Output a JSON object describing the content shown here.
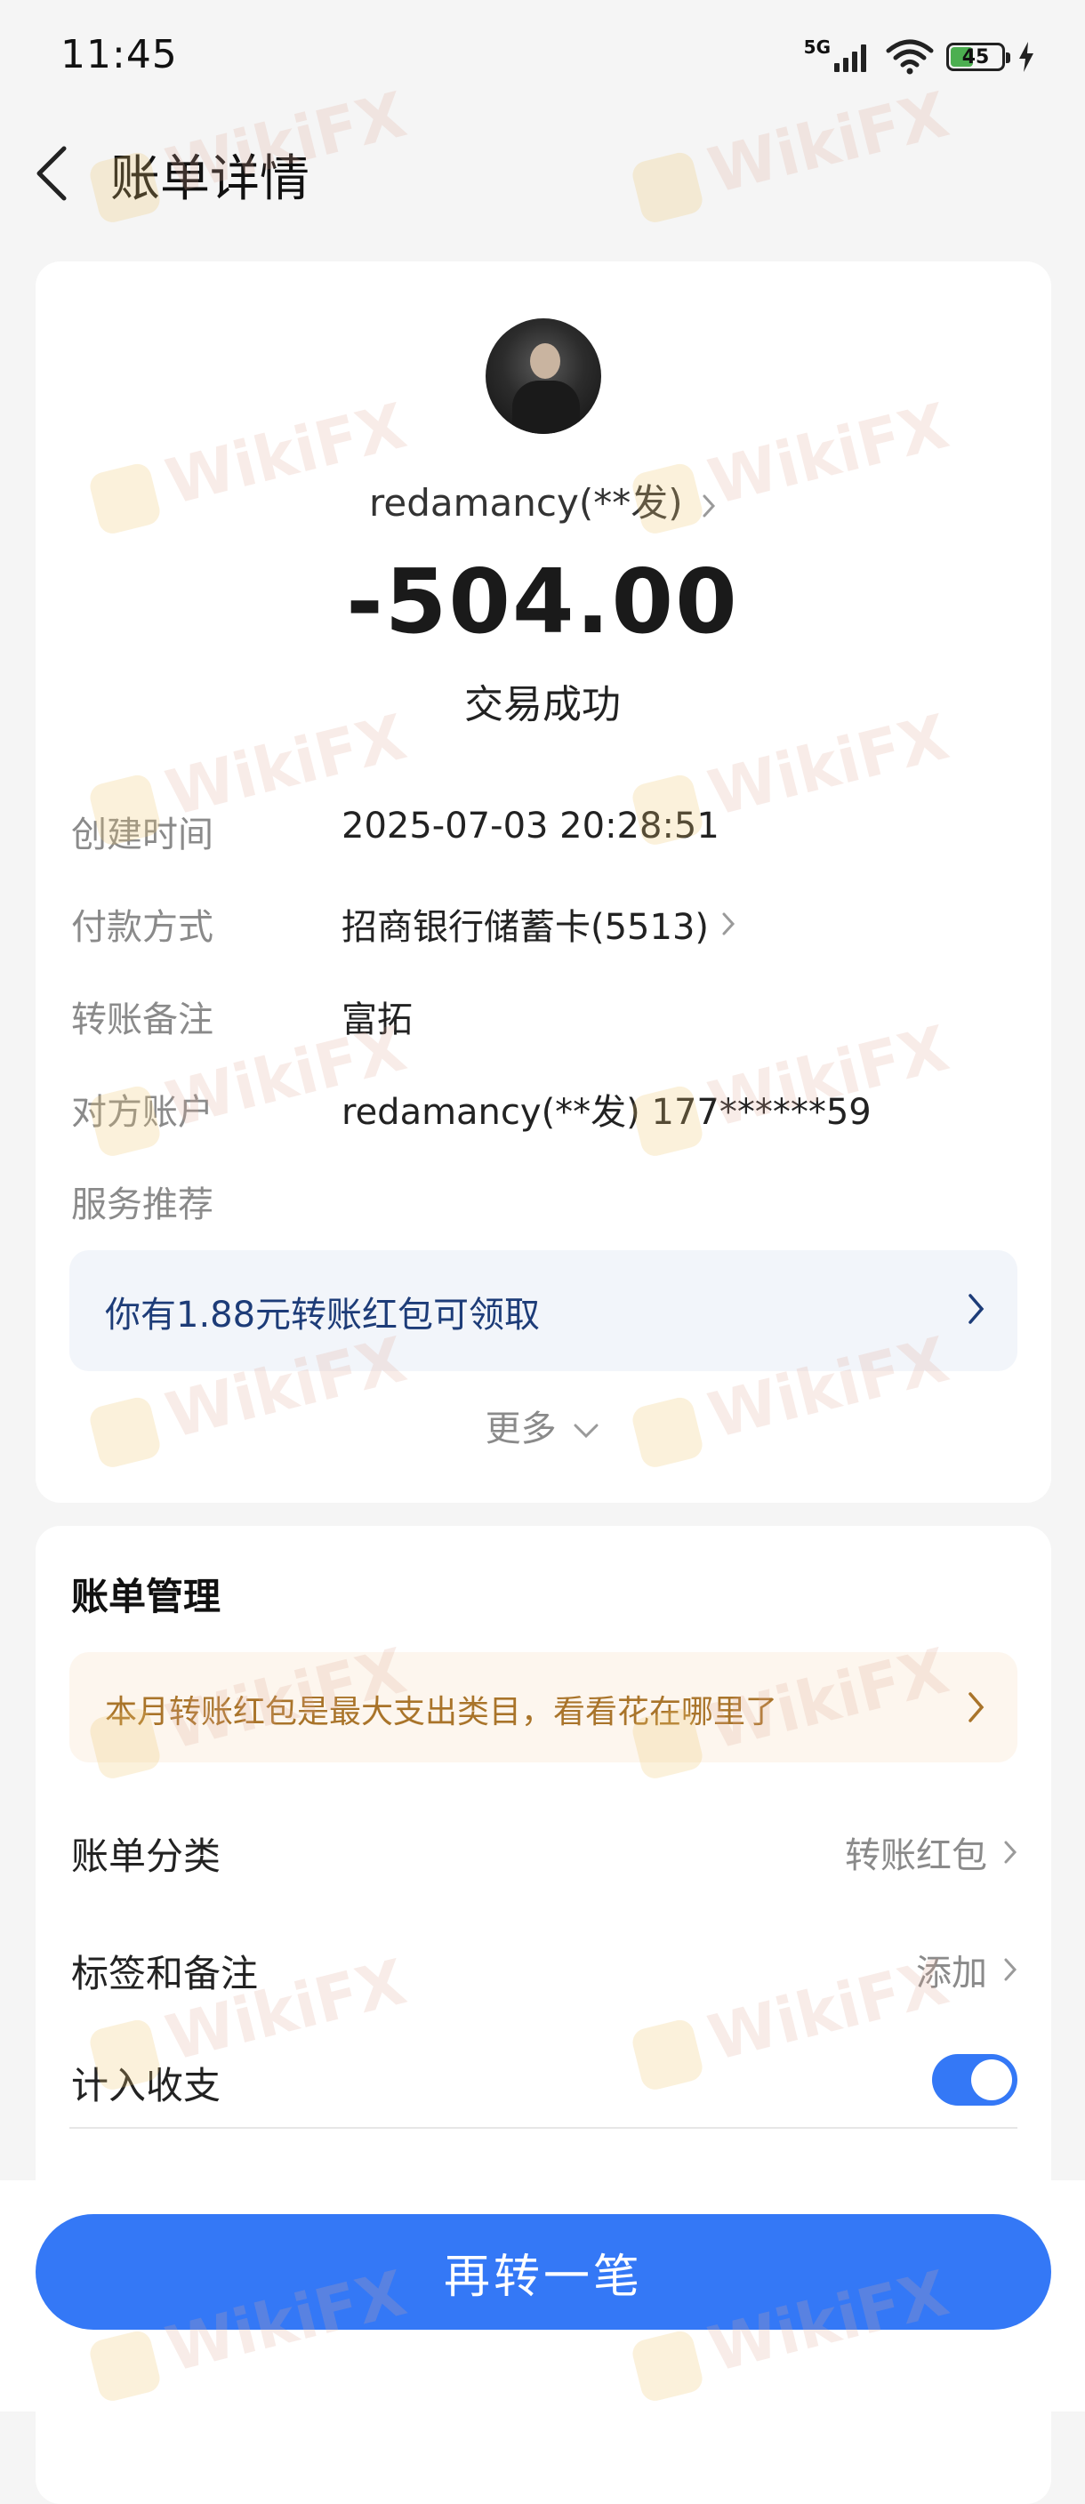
{
  "status_bar": {
    "time": "11:45",
    "network": "5G",
    "battery_level": "45",
    "battery_fraction": 0.45
  },
  "header": {
    "title": "账单详情"
  },
  "transaction": {
    "counterparty_name": "redamancy(**发)",
    "amount": "-504.00",
    "status": "交易成功"
  },
  "details": [
    {
      "label": "创建时间",
      "value": "2025-07-03 20:28:51",
      "has_chevron": false
    },
    {
      "label": "付款方式",
      "value": "招商银行储蓄卡(5513)",
      "has_chevron": true
    },
    {
      "label": "转账备注",
      "value": "富拓",
      "has_chevron": false
    },
    {
      "label": "对方账户",
      "value": "redamancy(**发) 177******59",
      "has_chevron": false
    },
    {
      "label": "服务推荐",
      "value": "",
      "has_chevron": false
    }
  ],
  "service_promo": {
    "text": "你有1.88元转账红包可领取"
  },
  "more": {
    "label": "更多"
  },
  "bill_management": {
    "title": "账单管理",
    "promo_text": "本月转账红包是最大支出类目，看看花在哪里了",
    "category": {
      "label": "账单分类",
      "value": "转账红包"
    },
    "tags": {
      "label": "标签和备注",
      "value": "添加"
    },
    "include": {
      "label": "计入收支",
      "enabled": true
    }
  },
  "cta": {
    "label": "再转一笔"
  },
  "watermark": {
    "text": "WikiFX"
  },
  "colors": {
    "accent": "#3478f6",
    "promo_blue_text": "#1d3c78",
    "promo_orange_text": "#a9742a",
    "battery_green": "#4caf50"
  }
}
